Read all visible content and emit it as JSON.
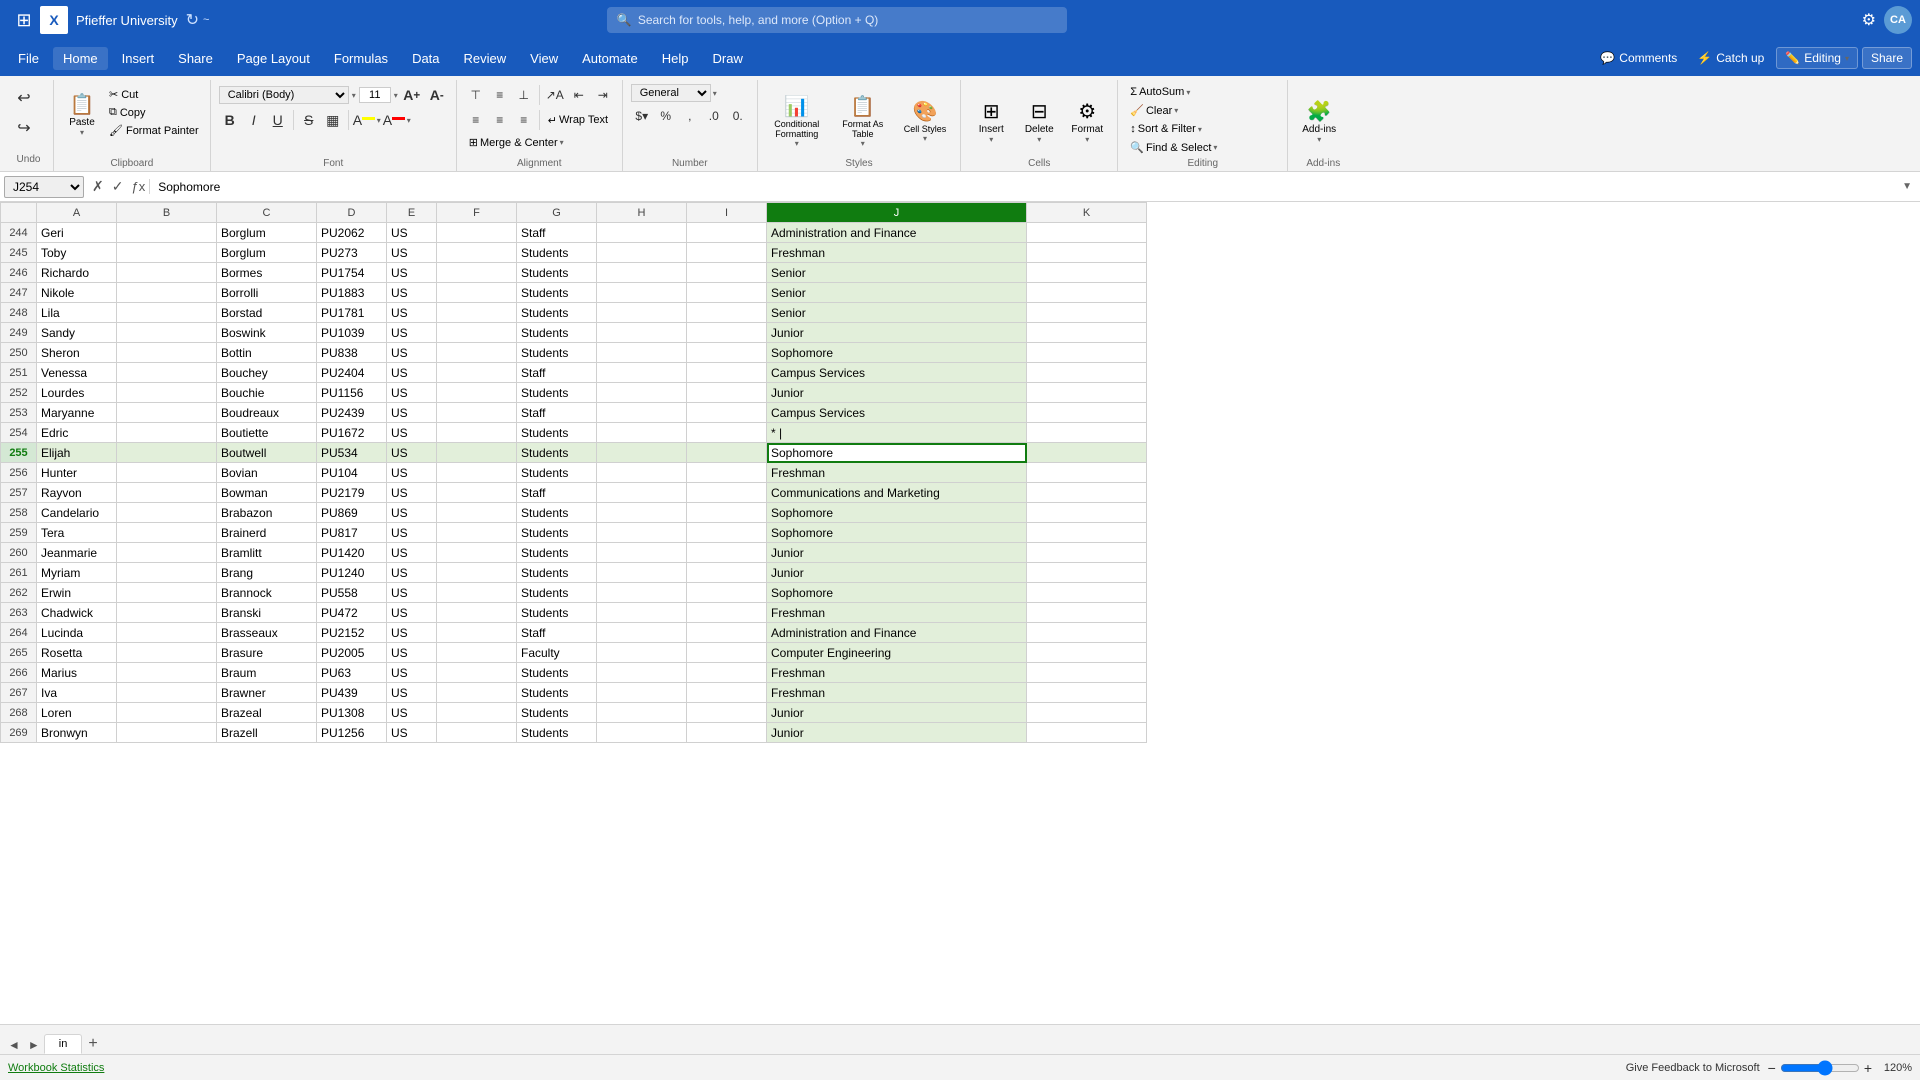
{
  "titleBar": {
    "appGridIcon": "⊞",
    "excelLogo": "X",
    "fileName": "Pfieffer University",
    "autosaveIcon": "↻",
    "searchPlaceholder": "Search for tools, help, and more (Option + Q)",
    "settingsIcon": "⚙",
    "avatarInitials": "CA"
  },
  "menuBar": {
    "items": [
      "File",
      "Home",
      "Insert",
      "Share",
      "Page Layout",
      "Formulas",
      "Data",
      "Review",
      "View",
      "Automate",
      "Help",
      "Draw"
    ],
    "activeItem": "Home",
    "rightButtons": {
      "comments": "Comments",
      "catchUp": "Catch up",
      "editing": "Editing",
      "share": "Share"
    }
  },
  "ribbon": {
    "groups": {
      "undo": {
        "label": "Undo"
      },
      "clipboard": {
        "label": "Clipboard",
        "paste": "Paste",
        "cut": "Cut",
        "copy": "Copy",
        "formatPainter": "Format Painter"
      },
      "font": {
        "label": "Font",
        "fontName": "Calibri (Body)",
        "fontSize": "11",
        "bold": "B",
        "italic": "I",
        "underline": "U",
        "strikethrough": "S",
        "increaseFont": "A↑",
        "decreaseFont": "A↓"
      },
      "alignment": {
        "label": "Alignment",
        "wrapText": "Wrap Text",
        "mergeCenterDropdown": "Merge & Center"
      },
      "number": {
        "label": "Number",
        "format": "General"
      },
      "styles": {
        "label": "Styles",
        "conditionalFormatting": "Conditional Formatting",
        "formatAsTable": "Format As Table",
        "cellStyles": "Cell Styles"
      },
      "cells": {
        "label": "Cells",
        "insert": "Insert",
        "delete": "Delete",
        "format": "Format"
      },
      "editing": {
        "label": "Editing",
        "autoSum": "AutoSum",
        "clear": "Clear",
        "sortFilter": "Sort & Filter",
        "findSelect": "Find & Select"
      },
      "addIns": {
        "label": "Add-ins",
        "addIns": "Add-ins"
      }
    }
  },
  "formulaBar": {
    "cellRef": "J254",
    "formula": "Sophomore"
  },
  "columns": {
    "headers": [
      "",
      "A",
      "B",
      "C",
      "D",
      "E",
      "F",
      "G",
      "H",
      "I",
      "J",
      "K"
    ],
    "activeColumn": "J"
  },
  "rows": [
    {
      "num": 244,
      "A": "Geri",
      "B": "",
      "C": "Borglum",
      "D": "PU2062",
      "E": "US",
      "F": "",
      "G": "Staff",
      "H": "",
      "I": "",
      "J": "Administration and Finance",
      "K": ""
    },
    {
      "num": 245,
      "A": "Toby",
      "B": "",
      "C": "Borglum",
      "D": "PU273",
      "E": "US",
      "F": "",
      "G": "Students",
      "H": "",
      "I": "",
      "J": "Freshman",
      "K": ""
    },
    {
      "num": 246,
      "A": "Richardo",
      "B": "",
      "C": "Bormes",
      "D": "PU1754",
      "E": "US",
      "F": "",
      "G": "Students",
      "H": "",
      "I": "",
      "J": "Senior",
      "K": ""
    },
    {
      "num": 247,
      "A": "Nikole",
      "B": "",
      "C": "Borrolli",
      "D": "PU1883",
      "E": "US",
      "F": "",
      "G": "Students",
      "H": "",
      "I": "",
      "J": "Senior",
      "K": ""
    },
    {
      "num": 248,
      "A": "Lila",
      "B": "",
      "C": "Borstad",
      "D": "PU1781",
      "E": "US",
      "F": "",
      "G": "Students",
      "H": "",
      "I": "",
      "J": "Senior",
      "K": ""
    },
    {
      "num": 249,
      "A": "Sandy",
      "B": "",
      "C": "Boswink",
      "D": "PU1039",
      "E": "US",
      "F": "",
      "G": "Students",
      "H": "",
      "I": "",
      "J": "Junior",
      "K": ""
    },
    {
      "num": 250,
      "A": "Sheron",
      "B": "",
      "C": "Bottin",
      "D": "PU838",
      "E": "US",
      "F": "",
      "G": "Students",
      "H": "",
      "I": "",
      "J": "Sophomore",
      "K": ""
    },
    {
      "num": 251,
      "A": "Venessa",
      "B": "",
      "C": "Bouchey",
      "D": "PU2404",
      "E": "US",
      "F": "",
      "G": "Staff",
      "H": "",
      "I": "",
      "J": "Campus Services",
      "K": ""
    },
    {
      "num": 252,
      "A": "Lourdes",
      "B": "",
      "C": "Bouchie",
      "D": "PU1156",
      "E": "US",
      "F": "",
      "G": "Students",
      "H": "",
      "I": "",
      "J": "Junior",
      "K": ""
    },
    {
      "num": 253,
      "A": "Maryanne",
      "B": "",
      "C": "Boudreaux",
      "D": "PU2439",
      "E": "US",
      "F": "",
      "G": "Staff",
      "H": "",
      "I": "",
      "J": "Campus Services",
      "K": ""
    },
    {
      "num": 254,
      "A": "Edric",
      "B": "",
      "C": "Boutiette",
      "D": "PU1672",
      "E": "US",
      "F": "",
      "G": "Students",
      "H": "",
      "I": "",
      "J": "* |",
      "K": ""
    },
    {
      "num": 255,
      "A": "Elijah",
      "B": "",
      "C": "Boutwell",
      "D": "PU534",
      "E": "US",
      "F": "",
      "G": "Students",
      "H": "",
      "I": "",
      "J": "Sophomore",
      "K": "",
      "selected": true
    },
    {
      "num": 256,
      "A": "Hunter",
      "B": "",
      "C": "Bovian",
      "D": "PU104",
      "E": "US",
      "F": "",
      "G": "Students",
      "H": "",
      "I": "",
      "J": "Freshman",
      "K": ""
    },
    {
      "num": 257,
      "A": "Rayvon",
      "B": "",
      "C": "Bowman",
      "D": "PU2179",
      "E": "US",
      "F": "",
      "G": "Staff",
      "H": "",
      "I": "",
      "J": "Communications and Marketing",
      "K": ""
    },
    {
      "num": 258,
      "A": "Candelario",
      "B": "",
      "C": "Brabazon",
      "D": "PU869",
      "E": "US",
      "F": "",
      "G": "Students",
      "H": "",
      "I": "",
      "J": "Sophomore",
      "K": ""
    },
    {
      "num": 259,
      "A": "Tera",
      "B": "",
      "C": "Brainerd",
      "D": "PU817",
      "E": "US",
      "F": "",
      "G": "Students",
      "H": "",
      "I": "",
      "J": "Sophomore",
      "K": ""
    },
    {
      "num": 260,
      "A": "Jeanmarie",
      "B": "",
      "C": "Bramlitt",
      "D": "PU1420",
      "E": "US",
      "F": "",
      "G": "Students",
      "H": "",
      "I": "",
      "J": "Junior",
      "K": ""
    },
    {
      "num": 261,
      "A": "Myriam",
      "B": "",
      "C": "Brang",
      "D": "PU1240",
      "E": "US",
      "F": "",
      "G": "Students",
      "H": "",
      "I": "",
      "J": "Junior",
      "K": ""
    },
    {
      "num": 262,
      "A": "Erwin",
      "B": "",
      "C": "Brannock",
      "D": "PU558",
      "E": "US",
      "F": "",
      "G": "Students",
      "H": "",
      "I": "",
      "J": "Sophomore",
      "K": ""
    },
    {
      "num": 263,
      "A": "Chadwick",
      "B": "",
      "C": "Branski",
      "D": "PU472",
      "E": "US",
      "F": "",
      "G": "Students",
      "H": "",
      "I": "",
      "J": "Freshman",
      "K": ""
    },
    {
      "num": 264,
      "A": "Lucinda",
      "B": "",
      "C": "Brasseaux",
      "D": "PU2152",
      "E": "US",
      "F": "",
      "G": "Staff",
      "H": "",
      "I": "",
      "J": "Administration and Finance",
      "K": ""
    },
    {
      "num": 265,
      "A": "Rosetta",
      "B": "",
      "C": "Brasure",
      "D": "PU2005",
      "E": "US",
      "F": "",
      "G": "Faculty",
      "H": "",
      "I": "",
      "J": "Computer Engineering",
      "K": ""
    },
    {
      "num": 266,
      "A": "Marius",
      "B": "",
      "C": "Braum",
      "D": "PU63",
      "E": "US",
      "F": "",
      "G": "Students",
      "H": "",
      "I": "",
      "J": "Freshman",
      "K": ""
    },
    {
      "num": 267,
      "A": "Iva",
      "B": "",
      "C": "Brawner",
      "D": "PU439",
      "E": "US",
      "F": "",
      "G": "Students",
      "H": "",
      "I": "",
      "J": "Freshman",
      "K": ""
    },
    {
      "num": 268,
      "A": "Loren",
      "B": "",
      "C": "Brazeal",
      "D": "PU1308",
      "E": "US",
      "F": "",
      "G": "Students",
      "H": "",
      "I": "",
      "J": "Junior",
      "K": ""
    },
    {
      "num": 269,
      "A": "Bronwyn",
      "B": "",
      "C": "Brazell",
      "D": "PU1256",
      "E": "US",
      "F": "",
      "G": "Students",
      "H": "",
      "I": "",
      "J": "Junior",
      "K": ""
    }
  ],
  "sheetTabs": {
    "tabs": [
      "in"
    ],
    "activeTab": "in",
    "addTabIcon": "+"
  },
  "statusBar": {
    "workbookStats": "Workbook Statistics",
    "feedback": "Give Feedback to Microsoft",
    "zoomOut": "−",
    "zoomIn": "+",
    "zoomLevel": "120%"
  }
}
